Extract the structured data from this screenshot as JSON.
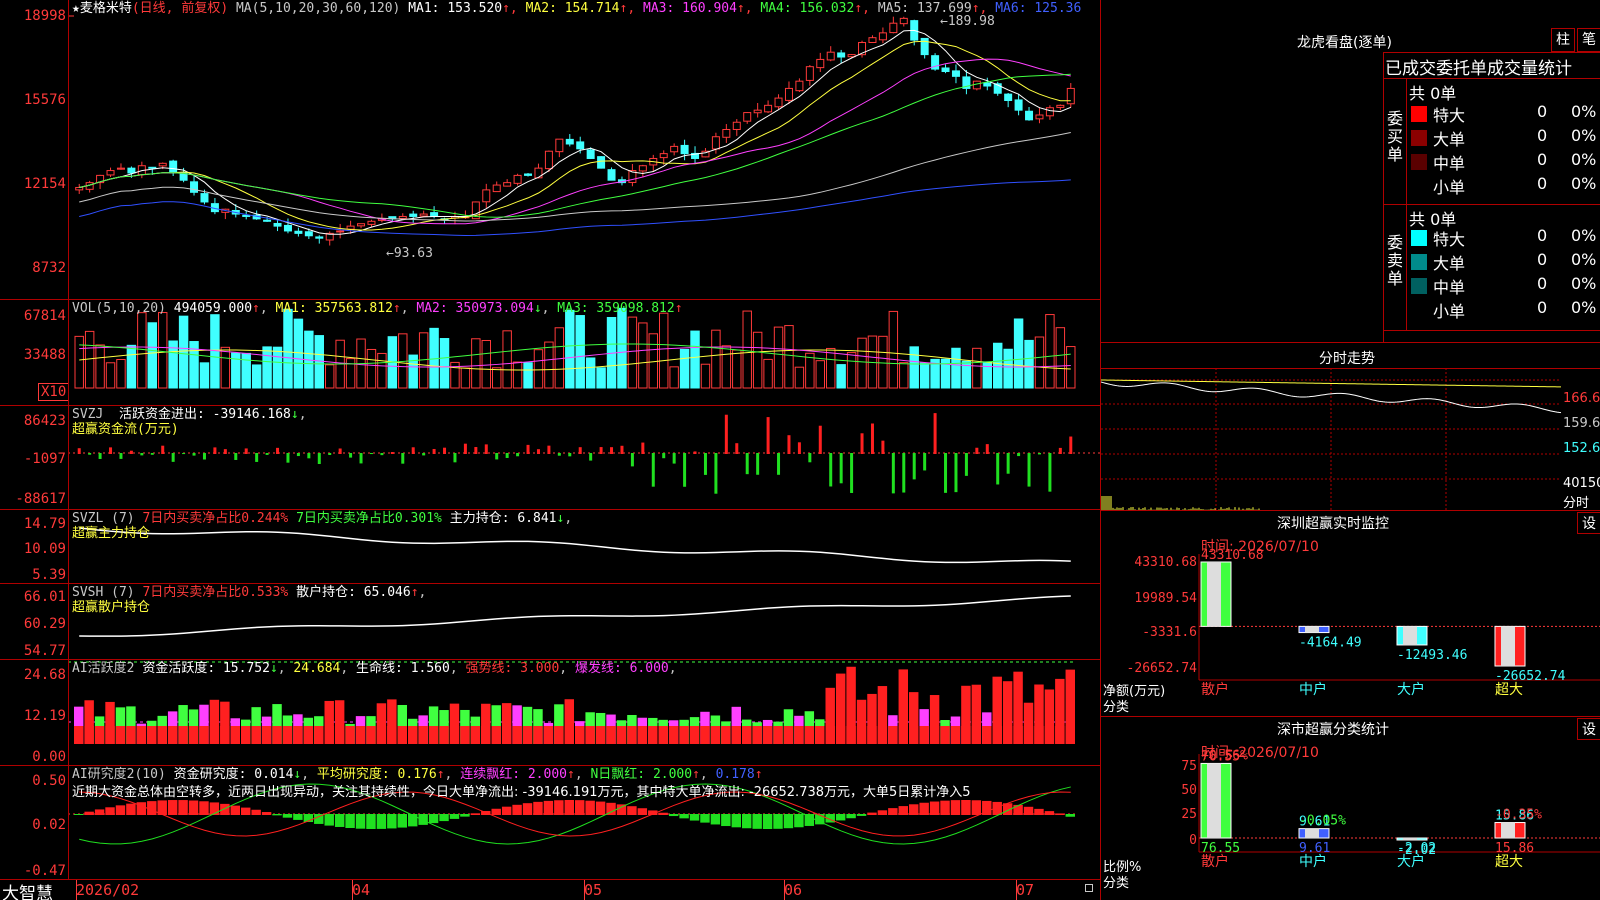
{
  "stock": {
    "star": "★",
    "name": "麦格米特",
    "mode": "(日线, 前复权)"
  },
  "main": {
    "ma_label": "MA(5,10,20,30,60,120)",
    "ma": [
      {
        "t": "MA1: 153.520",
        "arrow": "↑",
        "color": "#ffffff"
      },
      {
        "t": "MA2: 154.714",
        "arrow": "↑",
        "color": "#ffff40"
      },
      {
        "t": "MA3: 160.904",
        "arrow": "↑",
        "color": "#ff40ff"
      },
      {
        "t": "MA4: 156.032",
        "arrow": "↑",
        "color": "#40ff40"
      },
      {
        "t": "MA5: 137.699",
        "arrow": "↑",
        "color": "#c8c8c8"
      },
      {
        "t": "MA6: 125.36",
        "arrow": "",
        "color": "#4060ff"
      }
    ],
    "yticks": [
      "18998",
      "15576",
      "12154",
      "8732"
    ],
    "high_label": "189.98",
    "low_label": "93.63"
  },
  "vol": {
    "label": "VOL(5,10,20)",
    "value": "494059.000",
    "arrow": "↑",
    "ma1": "MA1: 357563.812",
    "ma1a": "↑",
    "ma2": "MA2: 350973.094",
    "ma2a": "↓",
    "ma3": "MA3: 359098.812",
    "ma3a": "↑",
    "yticks": [
      "67814",
      "33488"
    ],
    "unit": "X10"
  },
  "svzj": {
    "label": "SVZJ",
    "t1": "活跃资金进出: -39146.168",
    "a1": "↓",
    "t2": "超赢资金流(万元)",
    "yticks": [
      "86423",
      "-1097",
      "-88617"
    ]
  },
  "svzl": {
    "label": "SVZL (7)",
    "t1": "7日内买卖净占比0.244%",
    "t2": "7日内买卖净占比0.301%",
    "t3": "主力持仓: 6.841",
    "a3": "↓",
    "t4": "超赢主力持仓",
    "yticks": [
      "14.79",
      "10.09",
      "5.39"
    ]
  },
  "svsh": {
    "label": "SVSH (7)",
    "t1": "7日内买卖净占比0.533%",
    "t2": "散户持仓: 65.046",
    "a2": "↑",
    "t3": "超赢散户持仓",
    "yticks": [
      "66.01",
      "60.29",
      "54.77"
    ]
  },
  "ai1": {
    "label": "AI活跃度2",
    "t1": "资金活跃度: 15.752",
    "a1": "↓",
    "t2": "24.684",
    "t3": "生命线: 1.560",
    "t4": "强势线: 3.000",
    "t5": "爆发线: 6.000",
    "yticks": [
      "24.68",
      "12.19",
      "0.00"
    ]
  },
  "ai2": {
    "label": "AI研究度2(10)",
    "t1": "资金研究度: 0.014",
    "a1": "↓",
    "t2": "平均研究度: 0.176",
    "a2": "↑",
    "t3": "连续飘红: 2.000",
    "a3": "↑",
    "t4": "N日飘红: 2.000",
    "a4": "↑",
    "t5": "0.178",
    "a5": "↑",
    "desc": "近期大资金总体由空转多，近两日出现异动，关注其持续性，今日大单净流出: -39146.191万元，其中特大单净流出: -26652.738万元，大单5日累计净入5",
    "yticks": [
      "0.50",
      "0.02",
      "-0.47"
    ]
  },
  "xaxis": {
    "brand": "大智慧",
    "labels": [
      "2026/02",
      "04",
      "05",
      "06",
      "07"
    ]
  },
  "lhb": {
    "title": "龙虎看盘(逐单)",
    "btn1": "柱",
    "btn2": "笔",
    "header": "已成交委托单成交量统计",
    "buy_label": "委买单",
    "sell_label": "委卖单",
    "buy_total": "共 0单",
    "sell_total": "共 0单",
    "buy_rows": [
      {
        "name": "特大",
        "val": "0",
        "pct": "0%",
        "color": "#ff0000"
      },
      {
        "name": "大单",
        "val": "0",
        "pct": "0%",
        "color": "#8b0000"
      },
      {
        "name": "中单",
        "val": "0",
        "pct": "0%",
        "color": "#5a0000"
      },
      {
        "name": "小单",
        "val": "0",
        "pct": "0%",
        "color": "#000000"
      }
    ],
    "sell_rows": [
      {
        "name": "特大",
        "val": "0",
        "pct": "0%",
        "color": "#00ffff"
      },
      {
        "name": "大单",
        "val": "0",
        "pct": "0%",
        "color": "#008b8b"
      },
      {
        "name": "中单",
        "val": "0",
        "pct": "0%",
        "color": "#006060"
      },
      {
        "name": "小单",
        "val": "0",
        "pct": "0%",
        "color": "#000000"
      }
    ]
  },
  "fs": {
    "title": "分时走势",
    "yticks": [
      "166.6",
      "159.6",
      "152.6",
      "40150"
    ],
    "unit": "分时"
  },
  "sz1": {
    "title": "深圳超赢实时监控",
    "btn": "设",
    "time": "时间: 2026/07/10",
    "yticks": [
      "43310.68",
      "19989.54",
      "-3331.6",
      "-26652.74"
    ],
    "ylabel1": "净额(万元)",
    "ylabel2": "分类",
    "bars": [
      {
        "cat": "散户",
        "value": 43310.68,
        "label": "43310.68"
      },
      {
        "cat": "中户",
        "value": -4164.49,
        "label": "-4164.49"
      },
      {
        "cat": "大户",
        "value": -12493.46,
        "label": "-12493.46"
      },
      {
        "cat": "超大",
        "value": -26652.74,
        "label": "-26652.74"
      }
    ]
  },
  "sz2": {
    "title": "深市超赢分类统计",
    "btn": "设",
    "time": "时间: 2026/07/10",
    "yticks": [
      "75",
      "50",
      "25",
      "0"
    ],
    "ylabel1": "比例%",
    "ylabel2": "分类",
    "bars": [
      {
        "cat": "散户",
        "value": 76.55,
        "label": "76.55",
        "chg": "+0.56%"
      },
      {
        "cat": "中户",
        "value": 9.61,
        "label": "9.61",
        "chg": "-0.05%"
      },
      {
        "cat": "大户",
        "value": -2.02,
        "label": "-2.02",
        "chg": ""
      },
      {
        "cat": "超大",
        "value": 15.86,
        "label": "15.86",
        "chg": "-0.35%"
      }
    ]
  },
  "chart_data": [
    {
      "type": "candlestick",
      "title": "麦格米特",
      "series": [
        {
          "name": "MA1"
        },
        {
          "name": "MA2"
        },
        {
          "name": "MA3"
        },
        {
          "name": "MA4"
        },
        {
          "name": "MA5"
        },
        {
          "name": "MA6"
        }
      ],
      "close": [
        119,
        121,
        124,
        126,
        127,
        125,
        128,
        127,
        129,
        125,
        122,
        117,
        113,
        109,
        110,
        108,
        107,
        106,
        105,
        103,
        101,
        100,
        99,
        98,
        100,
        101,
        103,
        104,
        105,
        106,
        106,
        107,
        107,
        108,
        107,
        106,
        107,
        107,
        113,
        118,
        120,
        121,
        124,
        124,
        127,
        134,
        139,
        137,
        135,
        131,
        127,
        122,
        121,
        126,
        128,
        131,
        133,
        136,
        133,
        131,
        134,
        140,
        143,
        146,
        150,
        151,
        153,
        156,
        160,
        163,
        169,
        172,
        175,
        173,
        174,
        179,
        181,
        183,
        187,
        189,
        180,
        174,
        168,
        167,
        165,
        160,
        163,
        161,
        158,
        155,
        151,
        147,
        149,
        152,
        153,
        160
      ],
      "ylim": [
        87.32,
        189.98
      ]
    },
    {
      "type": "bar",
      "title": "VOL",
      "ylim": [
        0,
        678140
      ]
    },
    {
      "type": "bar",
      "title": "超赢资金流(万元)",
      "ylim": [
        -88617,
        86423
      ]
    },
    {
      "type": "line",
      "title": "超赢主力持仓",
      "ylim": [
        5.39,
        14.79
      ]
    },
    {
      "type": "line",
      "title": "超赢散户持仓",
      "ylim": [
        54.77,
        66.01
      ]
    },
    {
      "type": "bar",
      "title": "AI活跃度2",
      "ylim": [
        0,
        24.68
      ]
    },
    {
      "type": "bar",
      "title": "AI研究度2(10)",
      "ylim": [
        -0.47,
        0.5
      ]
    },
    {
      "type": "bar",
      "title": "深圳超赢实时监控",
      "categories": [
        "散户",
        "中户",
        "大户",
        "超大"
      ],
      "values": [
        43310.68,
        -4164.49,
        -12493.46,
        -26652.74
      ],
      "ylabel": "净额(万元)",
      "xlabel": "分类"
    },
    {
      "type": "bar",
      "title": "深市超赢分类统计",
      "categories": [
        "散户",
        "中户",
        "大户",
        "超大"
      ],
      "values": [
        76.55,
        9.61,
        -2.02,
        15.86
      ],
      "ylabel": "比例%",
      "xlabel": "分类",
      "ylim": [
        0,
        75
      ]
    }
  ]
}
